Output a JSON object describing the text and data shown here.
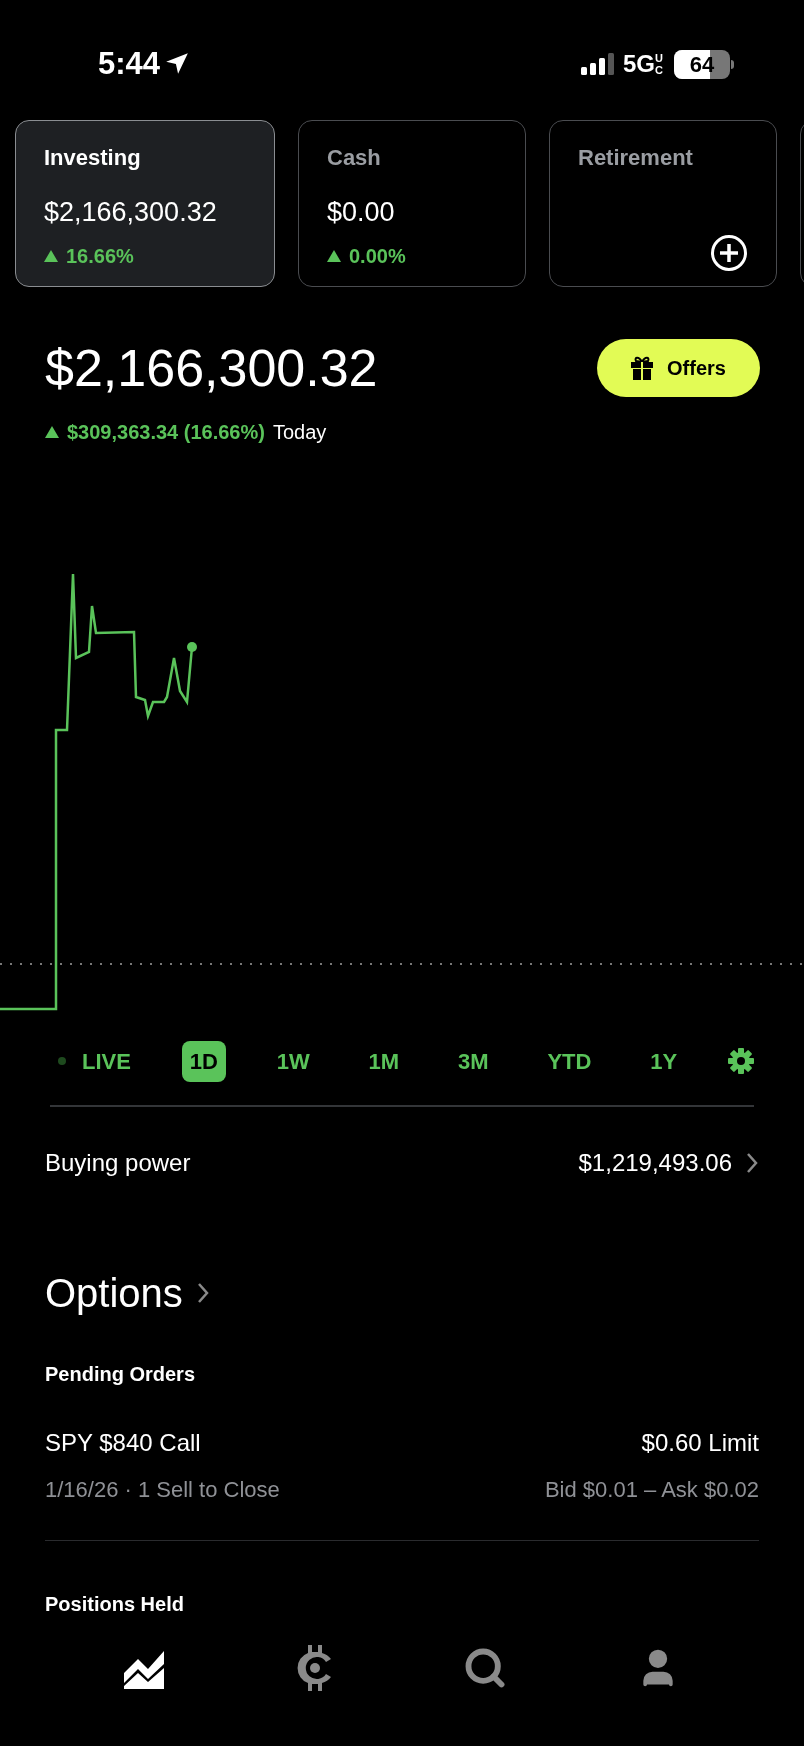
{
  "status_bar": {
    "time": "5:44",
    "network": "5G",
    "network_sub": "UC",
    "battery": "64"
  },
  "accounts": [
    {
      "kind": "balance",
      "name": "Investing",
      "value": "$2,166,300.32",
      "change": "16.66%",
      "selected": true
    },
    {
      "kind": "balance",
      "name": "Cash",
      "value": "$0.00",
      "change": "0.00%",
      "selected": false
    },
    {
      "kind": "add",
      "name": "Retirement",
      "selected": false
    }
  ],
  "portfolio": {
    "value": "$2,166,300.32",
    "change": "$309,363.34 (16.66%)",
    "period": "Today",
    "offers_button": "Offers"
  },
  "ranges": [
    {
      "label": "LIVE",
      "live": true,
      "selected": false
    },
    {
      "label": "1D",
      "live": false,
      "selected": true
    },
    {
      "label": "1W",
      "live": false,
      "selected": false
    },
    {
      "label": "1M",
      "live": false,
      "selected": false
    },
    {
      "label": "3M",
      "live": false,
      "selected": false
    },
    {
      "label": "YTD",
      "live": false,
      "selected": false
    },
    {
      "label": "1Y",
      "live": false,
      "selected": false
    }
  ],
  "buying_power": {
    "label": "Buying power",
    "value": "$1,219,493.06"
  },
  "options": {
    "title": "Options",
    "pending_title": "Pending Orders",
    "orders": [
      {
        "name": "SPY $840 Call",
        "detail": "1/16/26 · 1 Sell to Close",
        "price": "$0.60 Limit",
        "quote": "Bid $0.01 – Ask $0.02"
      }
    ],
    "positions_title": "Positions Held"
  },
  "nav": [
    {
      "kind": "chart",
      "selected": true
    },
    {
      "kind": "crypto",
      "selected": false
    },
    {
      "kind": "search",
      "selected": false
    },
    {
      "kind": "profile",
      "selected": false
    }
  ]
}
